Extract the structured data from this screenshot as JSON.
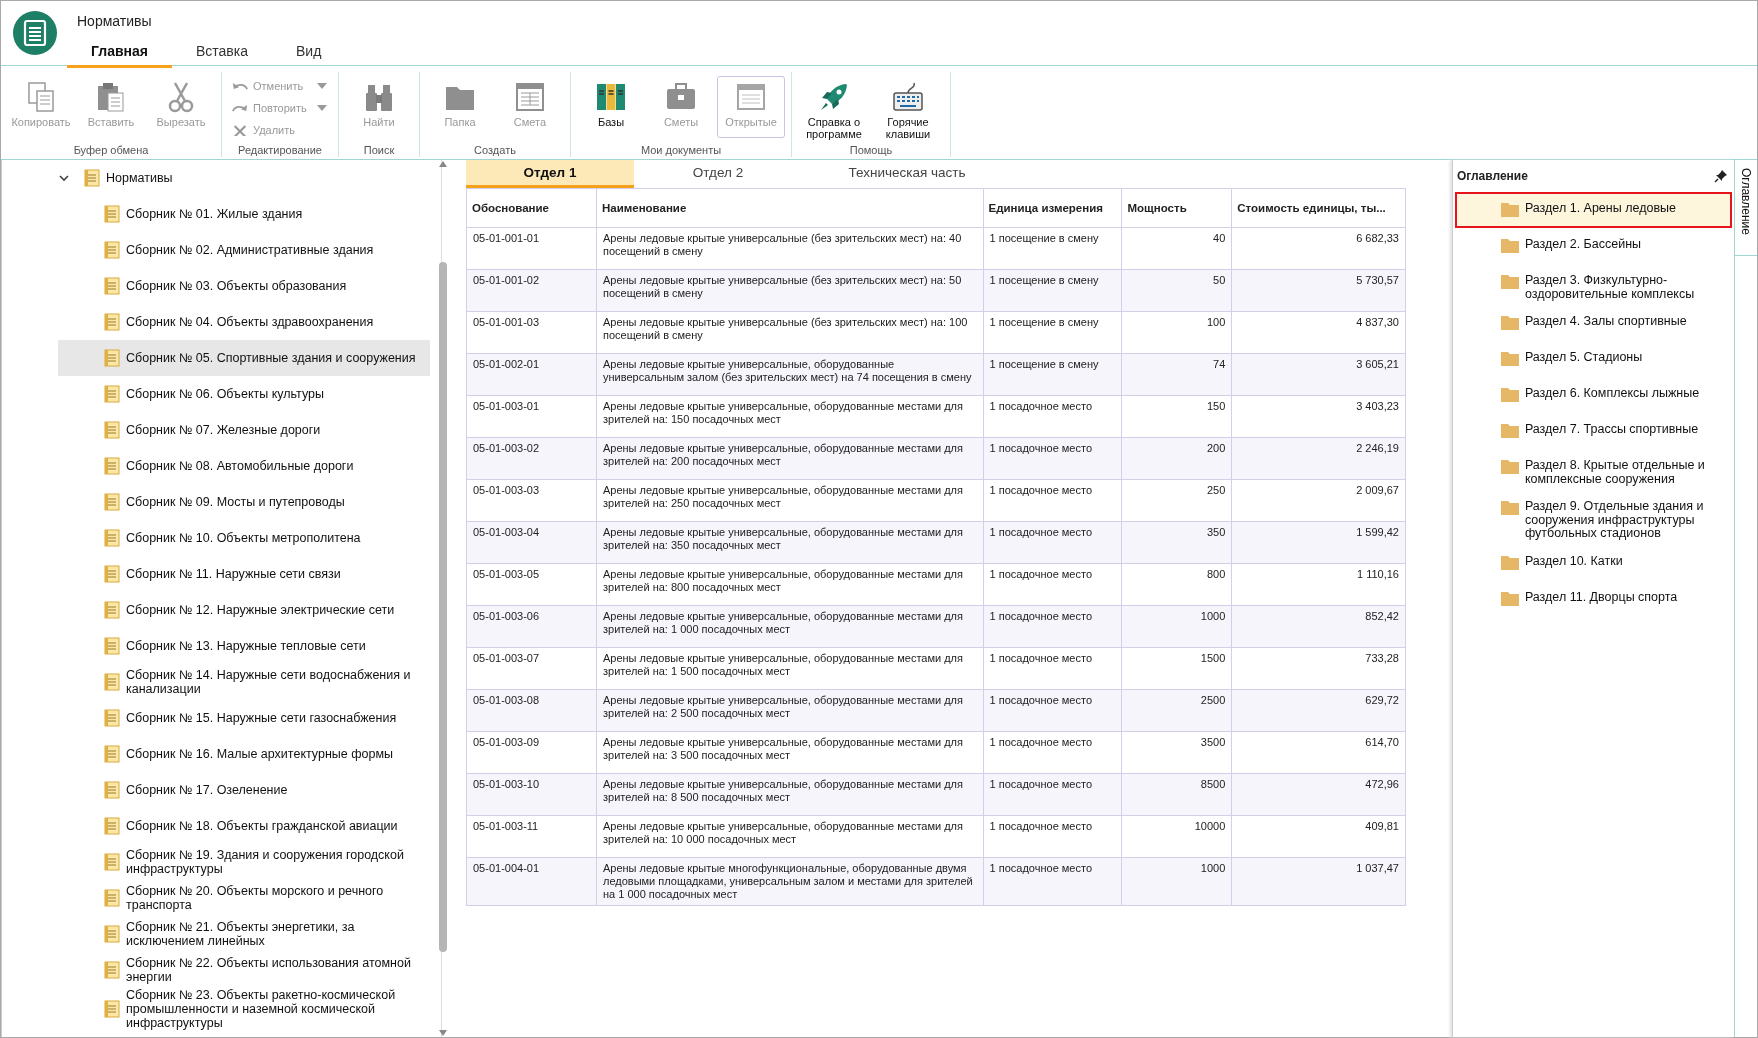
{
  "app": {
    "title": "Нормативы"
  },
  "menu_tabs": [
    {
      "label": "Главная",
      "selected": true
    },
    {
      "label": "Вставка",
      "selected": false
    },
    {
      "label": "Вид",
      "selected": false
    }
  ],
  "ribbon": [
    {
      "label": "Буфер обмена",
      "buttons": [
        {
          "kind": "large",
          "label": "Копировать",
          "disabled": true,
          "pressed": false
        },
        {
          "kind": "large",
          "label": "Вставить",
          "disabled": true,
          "pressed": false
        },
        {
          "kind": "large",
          "label": "Вырезать",
          "disabled": true,
          "pressed": false
        }
      ]
    },
    {
      "label": "Редактирование",
      "buttons": [
        {
          "kind": "small",
          "label": "Отменить",
          "disabled": true,
          "has_menu": true
        },
        {
          "kind": "small",
          "label": "Повторить",
          "disabled": true,
          "has_menu": true
        },
        {
          "kind": "small",
          "label": "Удалить",
          "disabled": true,
          "has_menu": false
        }
      ]
    },
    {
      "label": "Поиск",
      "buttons": [
        {
          "kind": "large",
          "label": "Найти",
          "disabled": true,
          "pressed": false
        }
      ]
    },
    {
      "label": "Создать",
      "buttons": [
        {
          "kind": "large",
          "label": "Папка",
          "disabled": true,
          "pressed": false
        },
        {
          "kind": "large",
          "label": "Смета",
          "disabled": true,
          "pressed": false
        }
      ]
    },
    {
      "label": "Мои документы",
      "buttons": [
        {
          "kind": "large",
          "label": "Базы",
          "disabled": false,
          "pressed": false
        },
        {
          "kind": "large",
          "label": "Сметы",
          "disabled": true,
          "pressed": false
        },
        {
          "kind": "large",
          "label": "Открытые",
          "disabled": true,
          "pressed": true
        }
      ]
    },
    {
      "label": "Помощь",
      "buttons": [
        {
          "kind": "large",
          "label": "Справка о программе",
          "disabled": false,
          "pressed": false
        },
        {
          "kind": "large",
          "label": "Горячие клавиши",
          "disabled": false,
          "pressed": false
        }
      ]
    }
  ],
  "tree": {
    "label": "Нормативы",
    "expanded": true,
    "children": [
      {
        "label": "Сборник № 01. Жилые здания",
        "selected": false
      },
      {
        "label": "Сборник № 02. Административные здания",
        "selected": false
      },
      {
        "label": "Сборник № 03. Объекты образования",
        "selected": false
      },
      {
        "label": "Сборник № 04. Объекты здравоохранения",
        "selected": false
      },
      {
        "label": "Сборник № 05. Спортивные здания и сооружения",
        "selected": true
      },
      {
        "label": "Сборник № 06. Объекты культуры",
        "selected": false
      },
      {
        "label": "Сборник № 07. Железные дороги",
        "selected": false
      },
      {
        "label": "Сборник № 08. Автомобильные дороги",
        "selected": false
      },
      {
        "label": "Сборник № 09. Мосты и путепроводы",
        "selected": false
      },
      {
        "label": "Сборник № 10. Объекты метрополитена",
        "selected": false
      },
      {
        "label": "Сборник № 11. Наружные сети связи",
        "selected": false
      },
      {
        "label": "Сборник № 12. Наружные электрические сети",
        "selected": false
      },
      {
        "label": "Сборник № 13. Наружные тепловые сети",
        "selected": false
      },
      {
        "label": "Сборник № 14. Наружные сети водоснабжения и канализации",
        "selected": false
      },
      {
        "label": "Сборник № 15. Наружные сети газоснабжения",
        "selected": false
      },
      {
        "label": "Сборник № 16. Малые архитектурные формы",
        "selected": false
      },
      {
        "label": "Сборник № 17. Озеленение",
        "selected": false
      },
      {
        "label": "Сборник № 18. Объекты гражданской авиации",
        "selected": false
      },
      {
        "label": "Сборник № 19. Здания и сооружения городской инфраструктуры",
        "selected": false
      },
      {
        "label": "Сборник № 20. Объекты морского и речного транспорта",
        "selected": false
      },
      {
        "label": "Сборник № 21. Объекты энергетики, за исключением линейных",
        "selected": false
      },
      {
        "label": "Сборник № 22. Объекты использования атомной энергии",
        "selected": false
      },
      {
        "label": "Сборник № 23. Объекты ракетно-космической промышленности и наземной космической инфраструктуры",
        "selected": false
      }
    ]
  },
  "content_tabs": [
    {
      "label": "Отдел 1",
      "selected": true
    },
    {
      "label": "Отдел 2",
      "selected": false
    },
    {
      "label": "Техническая часть",
      "selected": false
    }
  ],
  "table": {
    "columns": [
      "Обоснование",
      "Наименование",
      "Единица измерения",
      "Мощность",
      "Стоимость единицы, ты..."
    ],
    "rows": [
      [
        "05-01-001-01",
        "Арены ледовые крытые универсальные (без зрительских мест) на: 40 посещений в смену",
        "1 посещение в смену",
        "40",
        "6 682,33"
      ],
      [
        "05-01-001-02",
        "Арены ледовые крытые универсальные (без зрительских мест) на: 50 посещений в смену",
        "1 посещение в смену",
        "50",
        "5 730,57"
      ],
      [
        "05-01-001-03",
        "Арены ледовые крытые универсальные (без зрительских мест) на: 100 посещений в смену",
        "1 посещение в смену",
        "100",
        "4 837,30"
      ],
      [
        "05-01-002-01",
        "Арены ледовые крытые универсальные, оборудованные универсальным залом (без зрительских мест) на 74 посещения в смену",
        "1 посещение в смену",
        "74",
        "3 605,21"
      ],
      [
        "05-01-003-01",
        "Арены ледовые крытые универсальные, оборудованные местами для зрителей на: 150 посадочных мест",
        "1 посадочное место",
        "150",
        "3 403,23"
      ],
      [
        "05-01-003-02",
        "Арены ледовые крытые универсальные, оборудованные местами для зрителей на: 200 посадочных мест",
        "1 посадочное место",
        "200",
        "2 246,19"
      ],
      [
        "05-01-003-03",
        "Арены ледовые крытые универсальные, оборудованные местами для зрителей на: 250 посадочных мест",
        "1 посадочное место",
        "250",
        "2 009,67"
      ],
      [
        "05-01-003-04",
        "Арены ледовые крытые универсальные, оборудованные местами для зрителей на: 350 посадочных мест",
        "1 посадочное место",
        "350",
        "1 599,42"
      ],
      [
        "05-01-003-05",
        "Арены ледовые крытые универсальные, оборудованные местами для зрителей на: 800 посадочных мест",
        "1 посадочное место",
        "800",
        "1 110,16"
      ],
      [
        "05-01-003-06",
        "Арены ледовые крытые универсальные, оборудованные местами для зрителей на: 1 000 посадочных мест",
        "1 посадочное место",
        "1000",
        "852,42"
      ],
      [
        "05-01-003-07",
        "Арены ледовые крытые универсальные, оборудованные местами для зрителей на: 1 500 посадочных мест",
        "1 посадочное место",
        "1500",
        "733,28"
      ],
      [
        "05-01-003-08",
        "Арены ледовые крытые универсальные, оборудованные местами для зрителей на: 2 500 посадочных мест",
        "1 посадочное место",
        "2500",
        "629,72"
      ],
      [
        "05-01-003-09",
        "Арены ледовые крытые универсальные, оборудованные местами для зрителей на: 3 500 посадочных мест",
        "1 посадочное место",
        "3500",
        "614,70"
      ],
      [
        "05-01-003-10",
        "Арены ледовые крытые универсальные, оборудованные местами для зрителей на: 8 500 посадочных мест",
        "1 посадочное место",
        "8500",
        "472,96"
      ],
      [
        "05-01-003-11",
        "Арены ледовые крытые универсальные, оборудованные местами для зрителей на: 10 000 посадочных мест",
        "1 посадочное место",
        "10000",
        "409,81"
      ],
      [
        "05-01-004-01",
        "Арены ледовые крытые многофункциональные, оборудованные двумя ледовыми площадками, универсальным залом и местами для зрителей на 1 000 посадочных мест",
        "1 посадочное место",
        "1000",
        "1 037,47"
      ]
    ]
  },
  "toc": {
    "title": "Оглавление",
    "items": [
      {
        "label": "Раздел 1. Арены ледовые",
        "selected": true
      },
      {
        "label": "Раздел 2. Бассейны",
        "selected": false
      },
      {
        "label": "Раздел 3. Физкультурно-оздоровительные комплексы",
        "selected": false
      },
      {
        "label": "Раздел 4. Залы спортивные",
        "selected": false
      },
      {
        "label": "Раздел 5. Стадионы",
        "selected": false
      },
      {
        "label": "Раздел 6. Комплексы лыжные",
        "selected": false
      },
      {
        "label": "Раздел 7. Трассы спортивные",
        "selected": false
      },
      {
        "label": "Раздел 8. Крытые отдельные и комплексные сооружения",
        "selected": false
      },
      {
        "label": "Раздел 9. Отдельные здания и сооружения инфраструктуры футбольных стадионов",
        "selected": false
      },
      {
        "label": "Раздел 10. Катки",
        "selected": false
      },
      {
        "label": "Раздел 11. Дворцы спорта",
        "selected": false
      }
    ]
  },
  "side_tab": {
    "label": "Оглавление"
  }
}
